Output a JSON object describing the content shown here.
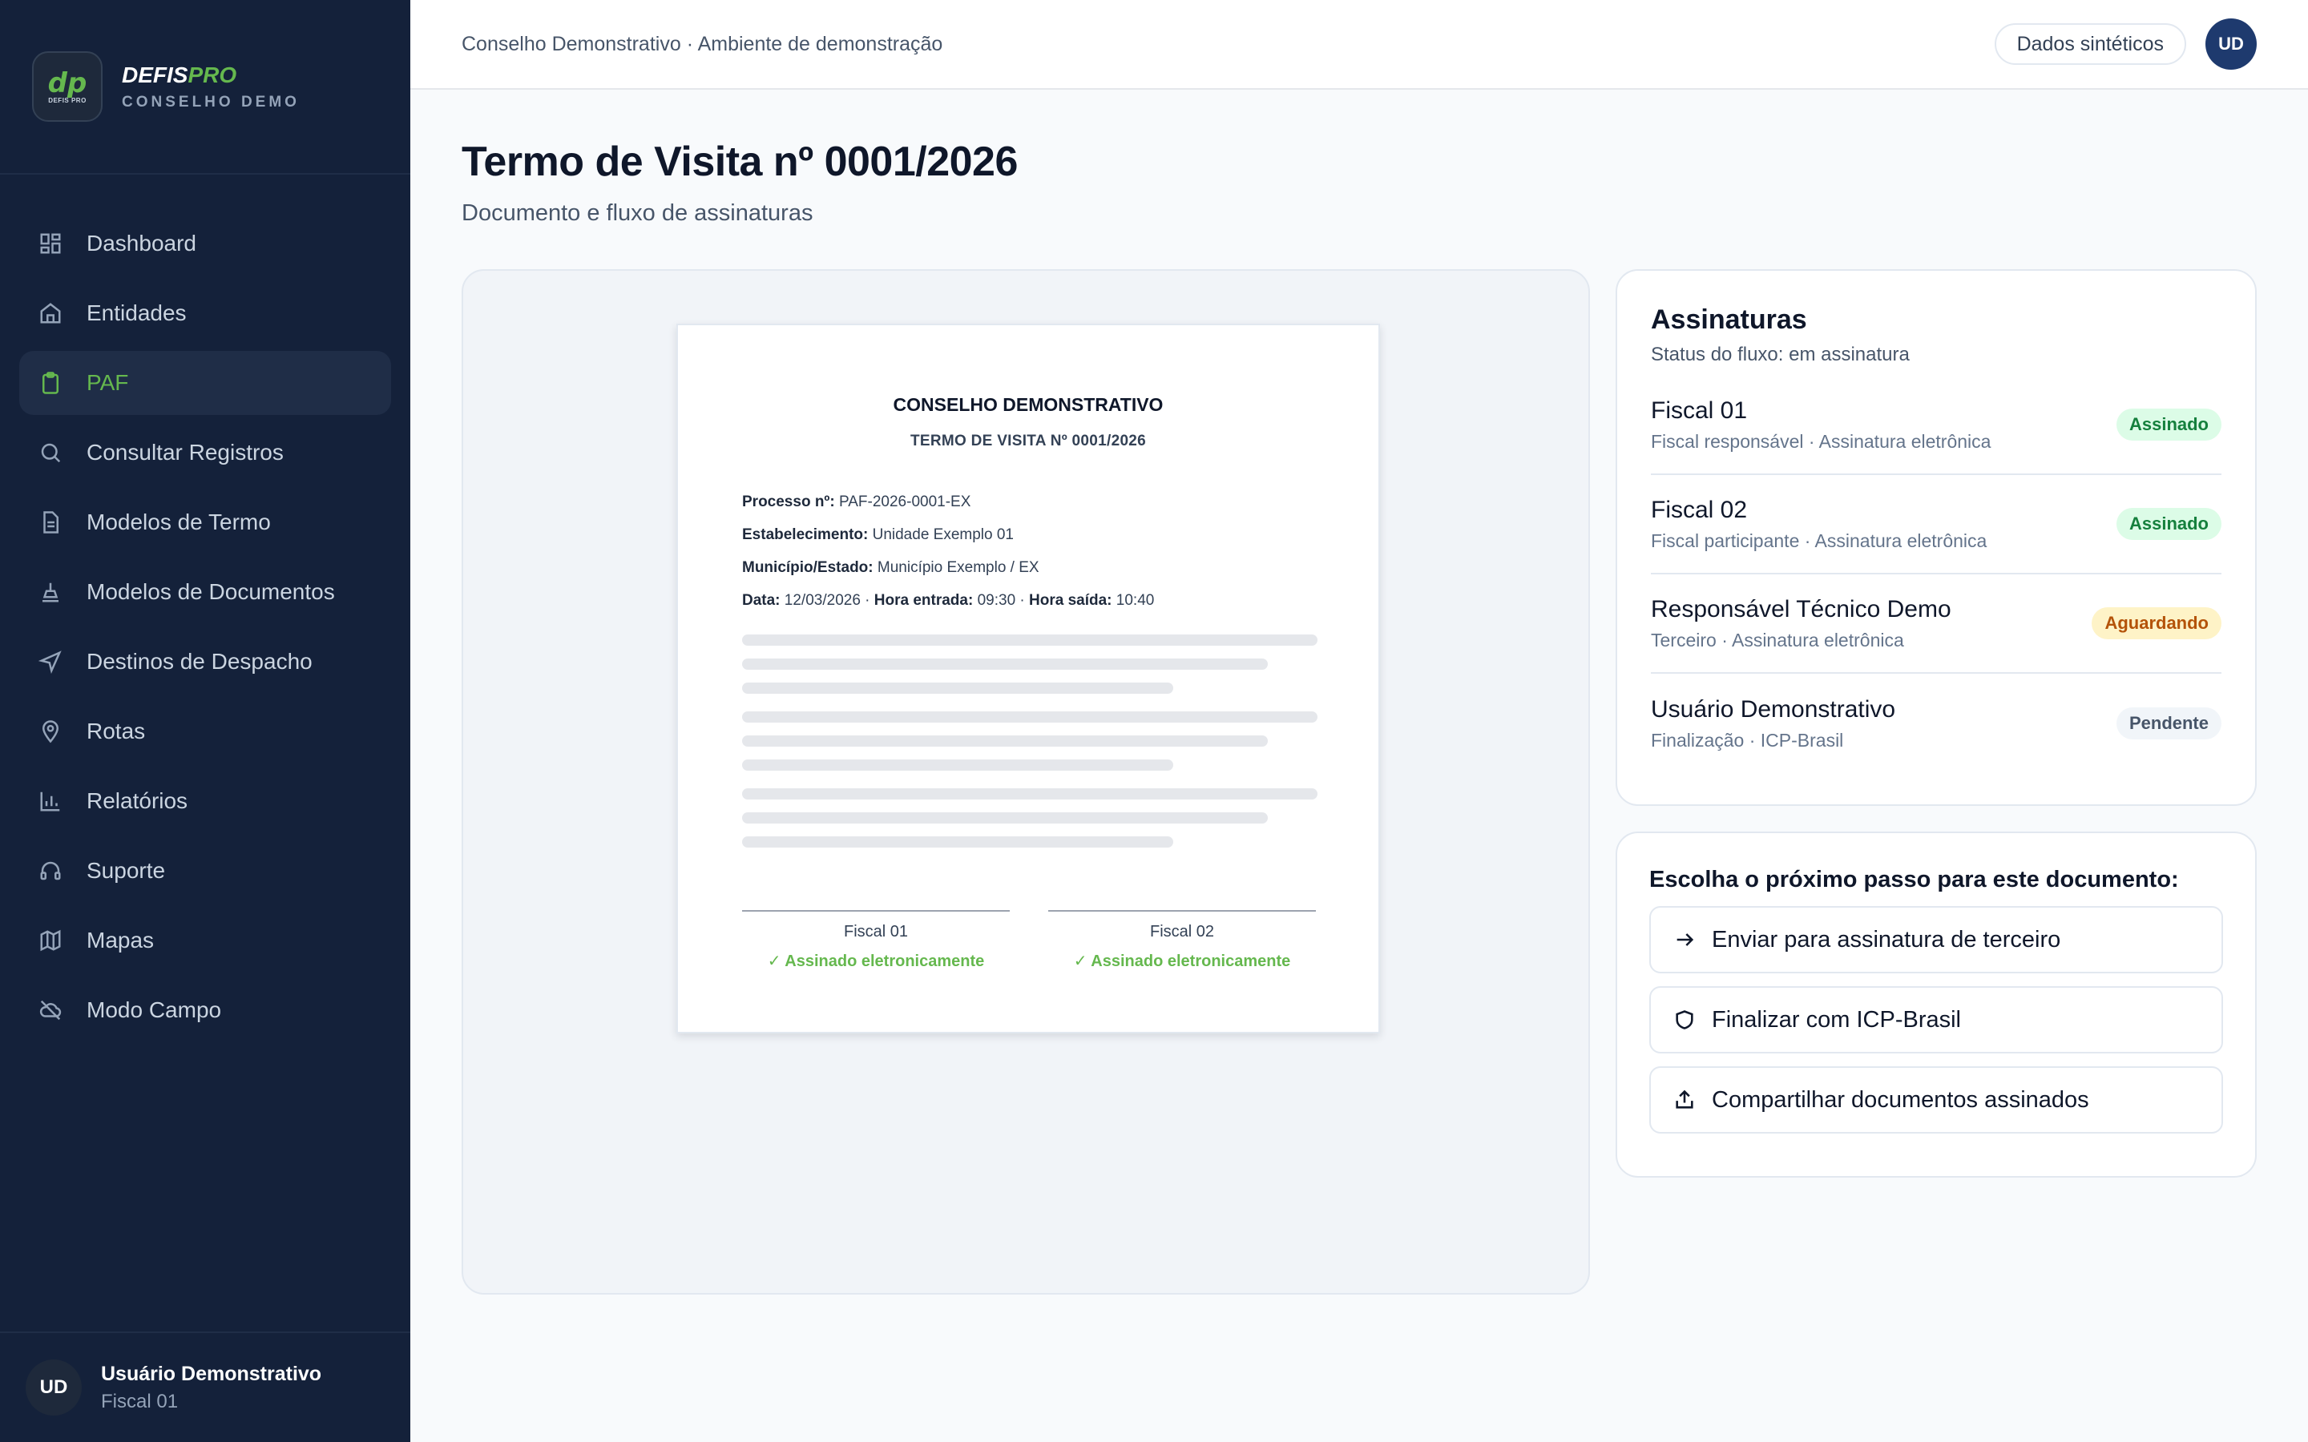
{
  "brand": {
    "logo_text": "dp",
    "logo_small": "DEFIS PRO",
    "name_main": "DEFIS",
    "name_accent": "PRO",
    "subtitle": "CONSELHO DEMO"
  },
  "sidebar": {
    "items": [
      {
        "label": "Dashboard",
        "icon": "dashboard-icon"
      },
      {
        "label": "Entidades",
        "icon": "building-icon"
      },
      {
        "label": "PAF",
        "icon": "clipboard-icon",
        "active": true
      },
      {
        "label": "Consultar Registros",
        "icon": "search-icon"
      },
      {
        "label": "Modelos de Termo",
        "icon": "document-icon"
      },
      {
        "label": "Modelos de Documentos",
        "icon": "stamp-icon"
      },
      {
        "label": "Destinos de Despacho",
        "icon": "send-icon"
      },
      {
        "label": "Rotas",
        "icon": "map-pin-icon"
      },
      {
        "label": "Relatórios",
        "icon": "bar-chart-icon"
      },
      {
        "label": "Suporte",
        "icon": "headset-icon"
      },
      {
        "label": "Mapas",
        "icon": "map-icon"
      },
      {
        "label": "Modo Campo",
        "icon": "cloud-off-icon"
      }
    ],
    "user": {
      "initials": "UD",
      "name": "Usuário Demonstrativo",
      "role": "Fiscal 01"
    }
  },
  "header": {
    "breadcrumb": "Conselho Demonstrativo · Ambiente de demonstração",
    "pill": "Dados sintéticos",
    "avatar_initials": "UD"
  },
  "page": {
    "title": "Termo de Visita nº 0001/2026",
    "subtitle": "Documento e fluxo de assinaturas"
  },
  "document": {
    "org": "CONSELHO DEMONSTRATIVO",
    "title": "TERMO DE VISITA Nº 0001/2026",
    "fields": {
      "processo_label": "Processo nº:",
      "processo_value": "PAF-2026-0001-EX",
      "estabelecimento_label": "Estabelecimento:",
      "estabelecimento_value": "Unidade Exemplo 01",
      "municipio_label": "Município/Estado:",
      "municipio_value": "Município Exemplo / EX",
      "data_label": "Data:",
      "data_value": "12/03/2026 ·",
      "entrada_label": "Hora entrada:",
      "entrada_value": "09:30 ·",
      "saida_label": "Hora saída:",
      "saida_value": "10:40"
    },
    "signatures": [
      {
        "name": "Fiscal 01",
        "status": "✓ Assinado eletronicamente"
      },
      {
        "name": "Fiscal 02",
        "status": "✓ Assinado eletronicamente"
      }
    ]
  },
  "signatures_panel": {
    "title": "Assinaturas",
    "status": "Status do fluxo: em assinatura",
    "signers": [
      {
        "name": "Fiscal 01",
        "desc": "Fiscal responsável · Assinatura eletrônica",
        "badge": "Assinado"
      },
      {
        "name": "Fiscal 02",
        "desc": "Fiscal participante · Assinatura eletrônica",
        "badge": "Assinado"
      },
      {
        "name": "Responsável Técnico Demo",
        "desc": "Terceiro · Assinatura eletrônica",
        "badge": "Aguardando"
      },
      {
        "name": "Usuário Demonstrativo",
        "desc": "Finalização · ICP-Brasil",
        "badge": "Pendente"
      }
    ]
  },
  "next_step": {
    "title": "Escolha o próximo passo para este documento:",
    "actions": [
      {
        "label": "Enviar para assinatura de terceiro",
        "icon": "arrow-right-icon"
      },
      {
        "label": "Finalizar com ICP-Brasil",
        "icon": "shield-icon"
      },
      {
        "label": "Compartilhar documentos assinados",
        "icon": "share-icon"
      }
    ]
  },
  "colors": {
    "sidebar_bg": "#14213a",
    "accent_green": "#65b84e",
    "badge_signed": "#15803d",
    "badge_waiting": "#b45309"
  }
}
